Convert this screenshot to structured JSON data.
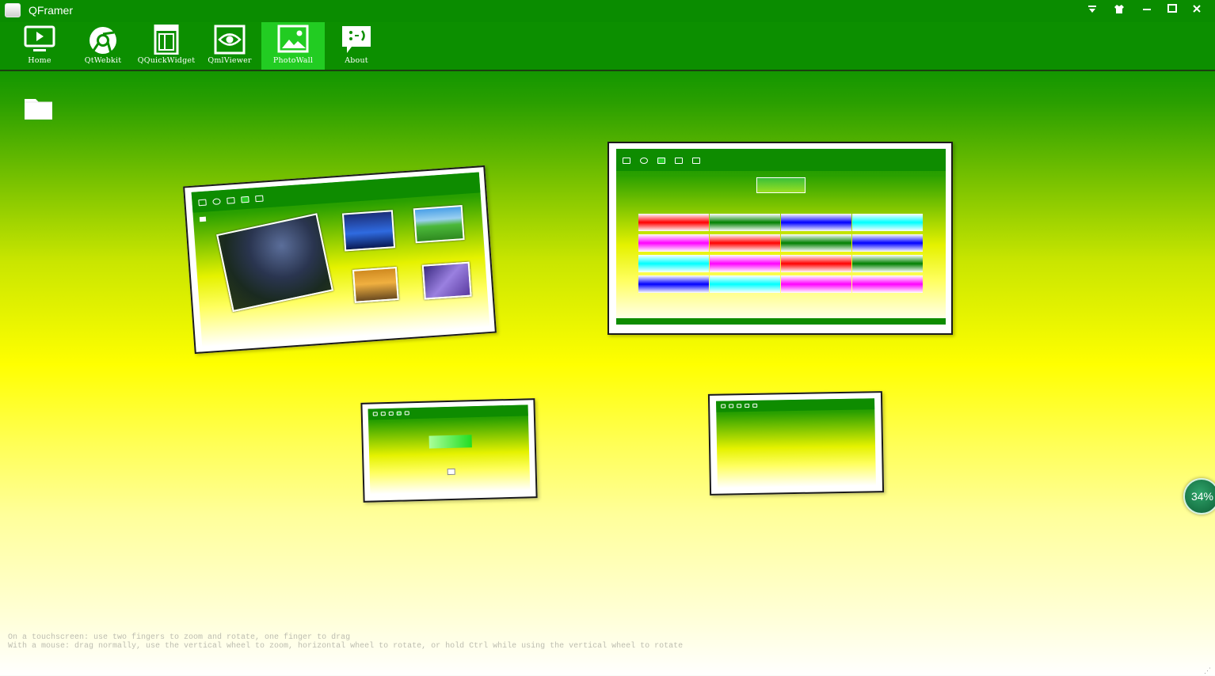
{
  "window": {
    "title": "QFramer",
    "controls": [
      "skin-dropdown-icon",
      "shirt-icon",
      "minimize-icon",
      "maximize-icon",
      "close-icon"
    ]
  },
  "toolbar": {
    "items": [
      {
        "label": "Home",
        "icon": "monitor-play-icon",
        "active": false
      },
      {
        "label": "QtWebkit",
        "icon": "browser-globe-icon",
        "active": false
      },
      {
        "label": "QQuickWidget",
        "icon": "layout-icon",
        "active": false
      },
      {
        "label": "QmlViewer",
        "icon": "eye-icon",
        "active": false
      },
      {
        "label": "PhotoWall",
        "icon": "picture-icon",
        "active": true
      },
      {
        "label": "About",
        "icon": "smiley-chat-icon",
        "active": false
      }
    ]
  },
  "photo_wall": {
    "folder_icon": "folder-icon",
    "photos": [
      {
        "name": "photo-photowall-screenshot",
        "rotation_deg": -4
      },
      {
        "name": "photo-gradient-grid-screenshot",
        "rotation_deg": 0
      },
      {
        "name": "photo-about-screenshot",
        "rotation_deg": -1.5
      },
      {
        "name": "photo-blank-screenshot",
        "rotation_deg": -1
      }
    ],
    "grid_colors": [
      "#ff0000",
      "#008000",
      "#0000ff",
      "#00ffff",
      "#ff00ff"
    ]
  },
  "hints": {
    "touch": "On a touchscreen: use two fingers to zoom and rotate, one finger to drag",
    "mouse": "With a mouse: drag normally, use the vertical wheel to zoom, horizontal wheel to rotate, or hold Ctrl while using the vertical wheel to rotate"
  },
  "progress": {
    "value": 34,
    "label": "34%"
  },
  "colors": {
    "accent": "#0c8f00",
    "active_tab": "#22cc22",
    "meter": "#1a7a4a"
  }
}
